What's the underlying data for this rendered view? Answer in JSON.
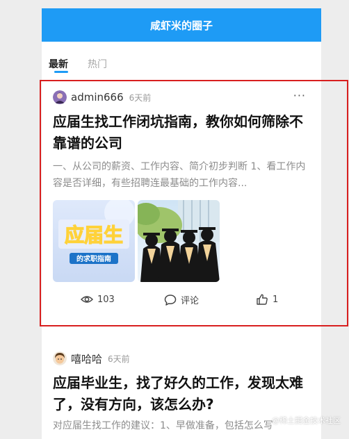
{
  "header": {
    "title": "咸虾米的圈子"
  },
  "tabs": [
    {
      "label": "最新"
    },
    {
      "label": "热门"
    }
  ],
  "posts": [
    {
      "author": "admin666",
      "time": "6天前",
      "title": "应届生找工作闭坑指南，教你如何筛除不靠谱的公司",
      "excerpt": "一、从公司的薪资、工作内容、简介初步判断 1、看工作内容是否详细，有些招聘连最基础的工作内容...",
      "thumbnail_text": {
        "main": "应届生",
        "sub": "的求职指南"
      },
      "stats": {
        "views": "103",
        "comments": "评论",
        "likes": "1"
      }
    },
    {
      "author": "嘻哈哈",
      "time": "6天前",
      "title": "应届毕业生，找了好久的工作，发现太难了，没有方向，该怎么办?",
      "excerpt": "对应届生找工作的建议：1、早做准备，包括怎么写"
    }
  ],
  "watermark": "@稀土掘金技术社区",
  "colors": {
    "accent": "#1e9bf5",
    "highlight_border": "#d81e1e"
  },
  "icons": {
    "more": "more-dots-icon",
    "views": "eye-icon",
    "comments": "comment-icon",
    "likes": "thumb-up-icon"
  }
}
